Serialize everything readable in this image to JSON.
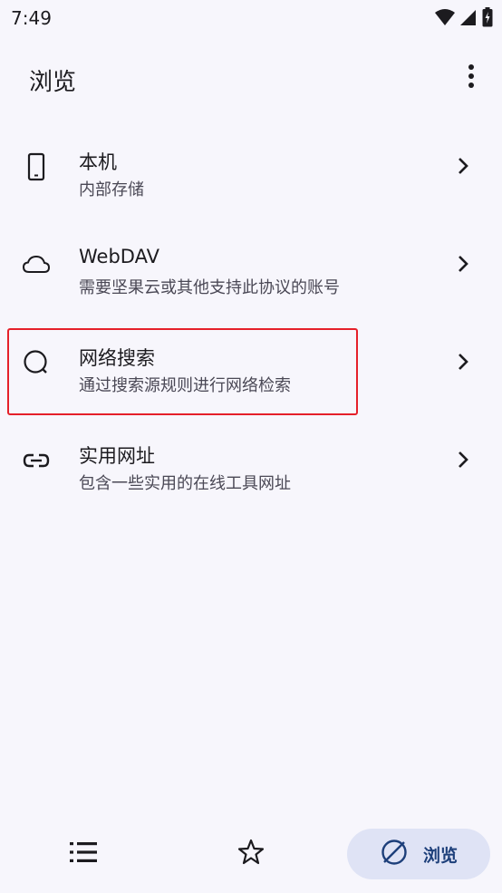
{
  "status_bar": {
    "time": "7:49"
  },
  "app_bar": {
    "title": "浏览",
    "more_icon": "more-vert-icon"
  },
  "list": [
    {
      "title": "本机",
      "subtitle": "内部存储",
      "icon": "phone-icon"
    },
    {
      "title": "WebDAV",
      "subtitle": "需要坚果云或其他支持此协议的账号",
      "icon": "cloud-icon"
    },
    {
      "title": "网络搜索",
      "subtitle": "通过搜索源规则进行网络检索",
      "icon": "search-icon"
    },
    {
      "title": "实用网址",
      "subtitle": "包含一些实用的在线工具网址",
      "icon": "link-icon"
    }
  ],
  "bottom_nav": {
    "items": [
      {
        "icon": "list-icon",
        "label": ""
      },
      {
        "icon": "star-icon",
        "label": ""
      },
      {
        "icon": "explore-icon",
        "label": "浏览"
      }
    ],
    "active_index": 2
  },
  "colors": {
    "background": "#f7f6fc",
    "highlight": "#e5202a",
    "nav_active_bg": "#dfe3f5",
    "nav_active_text": "#1d3f7a"
  }
}
